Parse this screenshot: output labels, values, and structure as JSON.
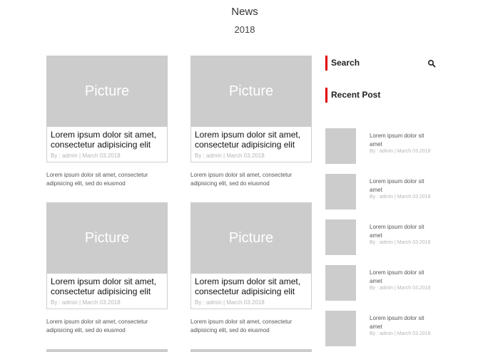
{
  "header": {
    "title": "News",
    "subtitle": "2018"
  },
  "posts": [
    {
      "image_label": "Picture",
      "title": "Lorem ipsum dolor sit amet, consectetur adipisicing elit",
      "meta": "By : admin | March 03.2018",
      "excerpt": "Lorem ipsum dolor sit amet, consectetur adipisicing elit, sed do eiusmod"
    },
    {
      "image_label": "Picture",
      "title": "Lorem ipsum dolor sit amet, consectetur adipisicing elit",
      "meta": "By : admin | March 03.2018",
      "excerpt": "Lorem ipsum dolor sit amet, consectetur adipisicing elit, sed do eiusmod"
    },
    {
      "image_label": "Picture",
      "title": "Lorem ipsum dolor sit amet, consectetur adipisicing elit",
      "meta": "By : admin | March 03.2018",
      "excerpt": "Lorem ipsum dolor sit amet, consectetur adipisicing elit, sed do eiusmod"
    },
    {
      "image_label": "Picture",
      "title": "Lorem ipsum dolor sit amet, consectetur adipisicing elit",
      "meta": "By : admin | March 03.2018",
      "excerpt": "Lorem ipsum dolor sit amet, consectetur adipisicing elit, sed do eiusmod"
    }
  ],
  "sidebar": {
    "search_label": "Search",
    "search_icon": "search-icon",
    "accent_color": "#e00000",
    "recent_label": "Recent Post",
    "recent_posts": [
      {
        "title": "Lorem ipsum dolor sit amet",
        "meta": "By : admin | March 03.2018"
      },
      {
        "title": "Lorem ipsum dolor sit amet",
        "meta": "By : admin | March 03.2018"
      },
      {
        "title": "Lorem ipsum dolor sit amet",
        "meta": "By : admin | March 03.2018"
      },
      {
        "title": "Lorem ipsum dolor sit amet",
        "meta": "By : admin | March 03.2018"
      },
      {
        "title": "Lorem ipsum dolor sit amet",
        "meta": "By : admin | March 03.2018"
      }
    ]
  }
}
